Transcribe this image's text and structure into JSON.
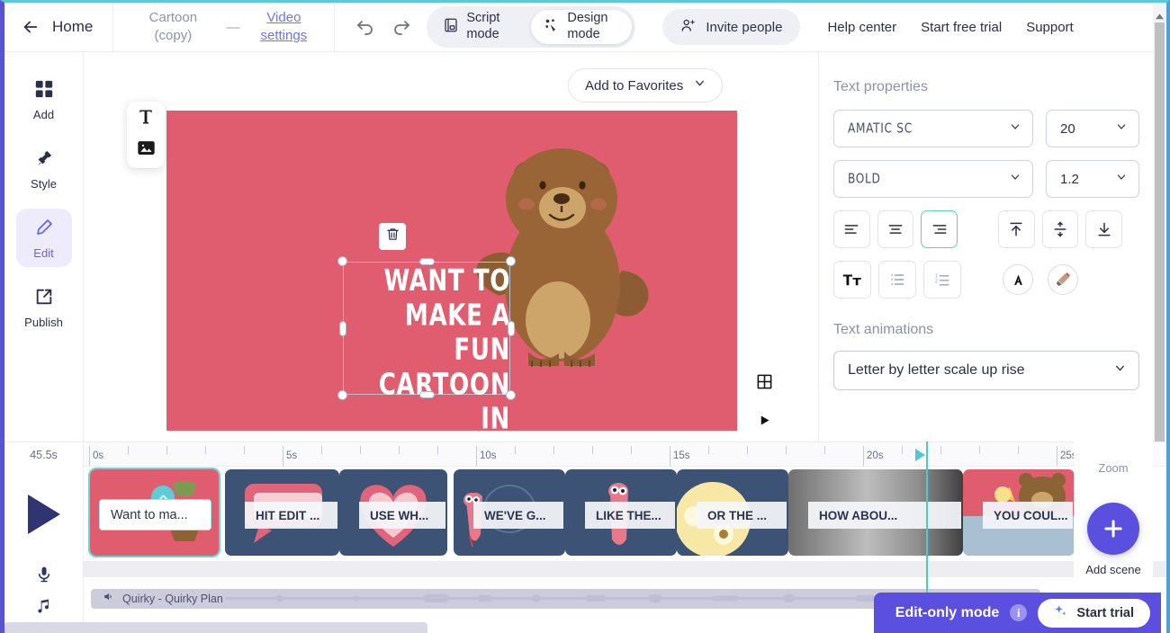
{
  "topbar": {
    "home_label": "Home",
    "project_name": "Cartoon (copy)",
    "project_dash": "—",
    "video_settings": "Video settings",
    "script_mode": "Script mode",
    "design_mode": "Design mode",
    "invite_label": "Invite people",
    "links": [
      "Help center",
      "Start free trial",
      "Support"
    ]
  },
  "sidebar": {
    "items": [
      {
        "label": "Add",
        "icon": "grid-icon"
      },
      {
        "label": "Style",
        "icon": "paint-roller-icon"
      },
      {
        "label": "Edit",
        "icon": "pencil-icon"
      },
      {
        "label": "Publish",
        "icon": "share-export-icon"
      }
    ],
    "active": "Edit"
  },
  "canvas": {
    "favorites_label": "Add to Favorites",
    "background_color": "#e05d6f",
    "text_line1": "Want to make a",
    "text_line2": "fun cartoon",
    "text_line3": "in minutes?",
    "text_color": "#ffffff",
    "tools": [
      "text-tool",
      "image-tool"
    ],
    "delete_label": "delete",
    "grid_label": "grid",
    "play_label": "play"
  },
  "text_properties": {
    "title": "Text properties",
    "font_family": "Amatic SC",
    "font_size": "20",
    "font_weight": "Bold",
    "line_height": "1.2",
    "align_buttons": [
      "align-left",
      "align-center",
      "align-right"
    ],
    "align_active": "align-right",
    "vertical_buttons": [
      "valign-top",
      "valign-middle",
      "valign-bottom"
    ],
    "case_button": "text-case",
    "list_buttons": [
      "bullet-list",
      "numbered-list"
    ],
    "color_button": "font-color",
    "highlight_button": "highlight-color"
  },
  "text_animations": {
    "title": "Text animations",
    "selected": "Letter by letter scale up rise"
  },
  "timeline": {
    "duration": "45.5s",
    "ruler_labels": [
      "0s",
      "5s",
      "10s",
      "15s",
      "20s",
      "25s"
    ],
    "scenes": [
      {
        "caption": "Want to ma...",
        "bg": "#e05d6f",
        "selected": true,
        "art": "plant"
      },
      {
        "caption": "HIT EDIT ...",
        "bg": "#3c5375",
        "selected": false,
        "art": "speech-bubble"
      },
      {
        "caption": "USE WH...",
        "bg": "#3c5375",
        "selected": false,
        "art": "heart"
      },
      {
        "caption": "WE'VE G...",
        "bg": "#3c5375",
        "selected": false,
        "art": "worm"
      },
      {
        "caption": "LIKE THE...",
        "bg": "#3c5375",
        "selected": false,
        "art": "worm"
      },
      {
        "caption": "OR THE ...",
        "bg": "#3c5375",
        "selected": false,
        "art": "cheese"
      },
      {
        "caption": "HOW ABOU...",
        "bg": "#808080",
        "selected": false,
        "art": "gray"
      },
      {
        "caption": "YOU COUL...",
        "bg": "#e05d6f",
        "selected": false,
        "art": "bear"
      }
    ],
    "audio_track": "Quirky - Quirky Plan",
    "zoom_label": "Zoom",
    "add_scene_label": "Add scene"
  },
  "status_bar": {
    "edit_only_label": "Edit-only mode",
    "info_glyph": "i",
    "start_trial_label": "Start trial"
  }
}
